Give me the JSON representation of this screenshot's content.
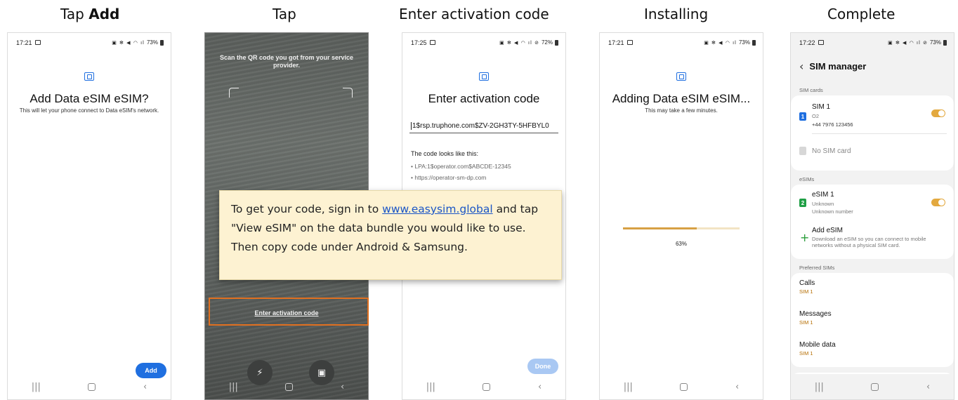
{
  "captions": {
    "step1_prefix": "Tap ",
    "step1_bold": "Add",
    "step2": "Tap",
    "step3": "Enter activation code",
    "step4": "Installing",
    "step5": "Complete"
  },
  "tip": {
    "text_before": "To get your code, sign in to ",
    "link": "www.easysim.global",
    "text_after": " and tap \"View eSIM\" on the data bundle you would like to use. Then copy code under Android & Samsung."
  },
  "phone1": {
    "time": "17:21",
    "battery": "73%",
    "title": "Add Data eSIM eSIM?",
    "subtitle": "This will let your phone connect to Data eSIM's network.",
    "add_button": "Add"
  },
  "phone2": {
    "scan_text": "Scan the QR code you got from your service provider.",
    "enter_link": "Enter activation code",
    "flashlight_icon": "flashlight-icon",
    "gallery_icon": "gallery-icon"
  },
  "phone3": {
    "time": "17:25",
    "battery": "72%",
    "title": "Enter activation code",
    "code_value": "1$rsp.truphone.com$ZV-2GH3TY-5HFBYL0",
    "looks_like": "The code looks like this:",
    "example1": "• LPA:1$operator.com$ABCDE-12345",
    "example2": "• https://operator-sm-dp.com",
    "done_button": "Done"
  },
  "phone4": {
    "time": "17:21",
    "battery": "73%",
    "title": "Adding Data eSIM eSIM...",
    "subtitle": "This may take a few minutes.",
    "progress": 63,
    "progress_label": "63%"
  },
  "phone5": {
    "time": "17:22",
    "battery": "73%",
    "header": "SIM manager",
    "sim_cards_label": "SIM cards",
    "sim1_name": "SIM 1",
    "sim1_carrier": "O2",
    "sim1_number": "+44 7976 123456",
    "no_sim": "No SIM card",
    "esims_label": "eSIMs",
    "esim1_name": "eSIM 1",
    "esim1_status": "Unknown",
    "esim1_number": "Unknown number",
    "add_esim": "Add eSIM",
    "add_esim_desc": "Download an eSIM so you can connect to mobile networks without a physical SIM card.",
    "preferred_label": "Preferred SIMs",
    "calls": "Calls",
    "calls_sim": "SIM 1",
    "messages": "Messages",
    "messages_sim": "SIM 1",
    "mobile_data": "Mobile data",
    "mobile_data_sim": "SIM 1"
  },
  "colors": {
    "accent_blue": "#1f6fe0",
    "highlight_orange": "#e07020",
    "tip_background": "#fdf2d2",
    "toggle_on": "#e3a93f"
  }
}
